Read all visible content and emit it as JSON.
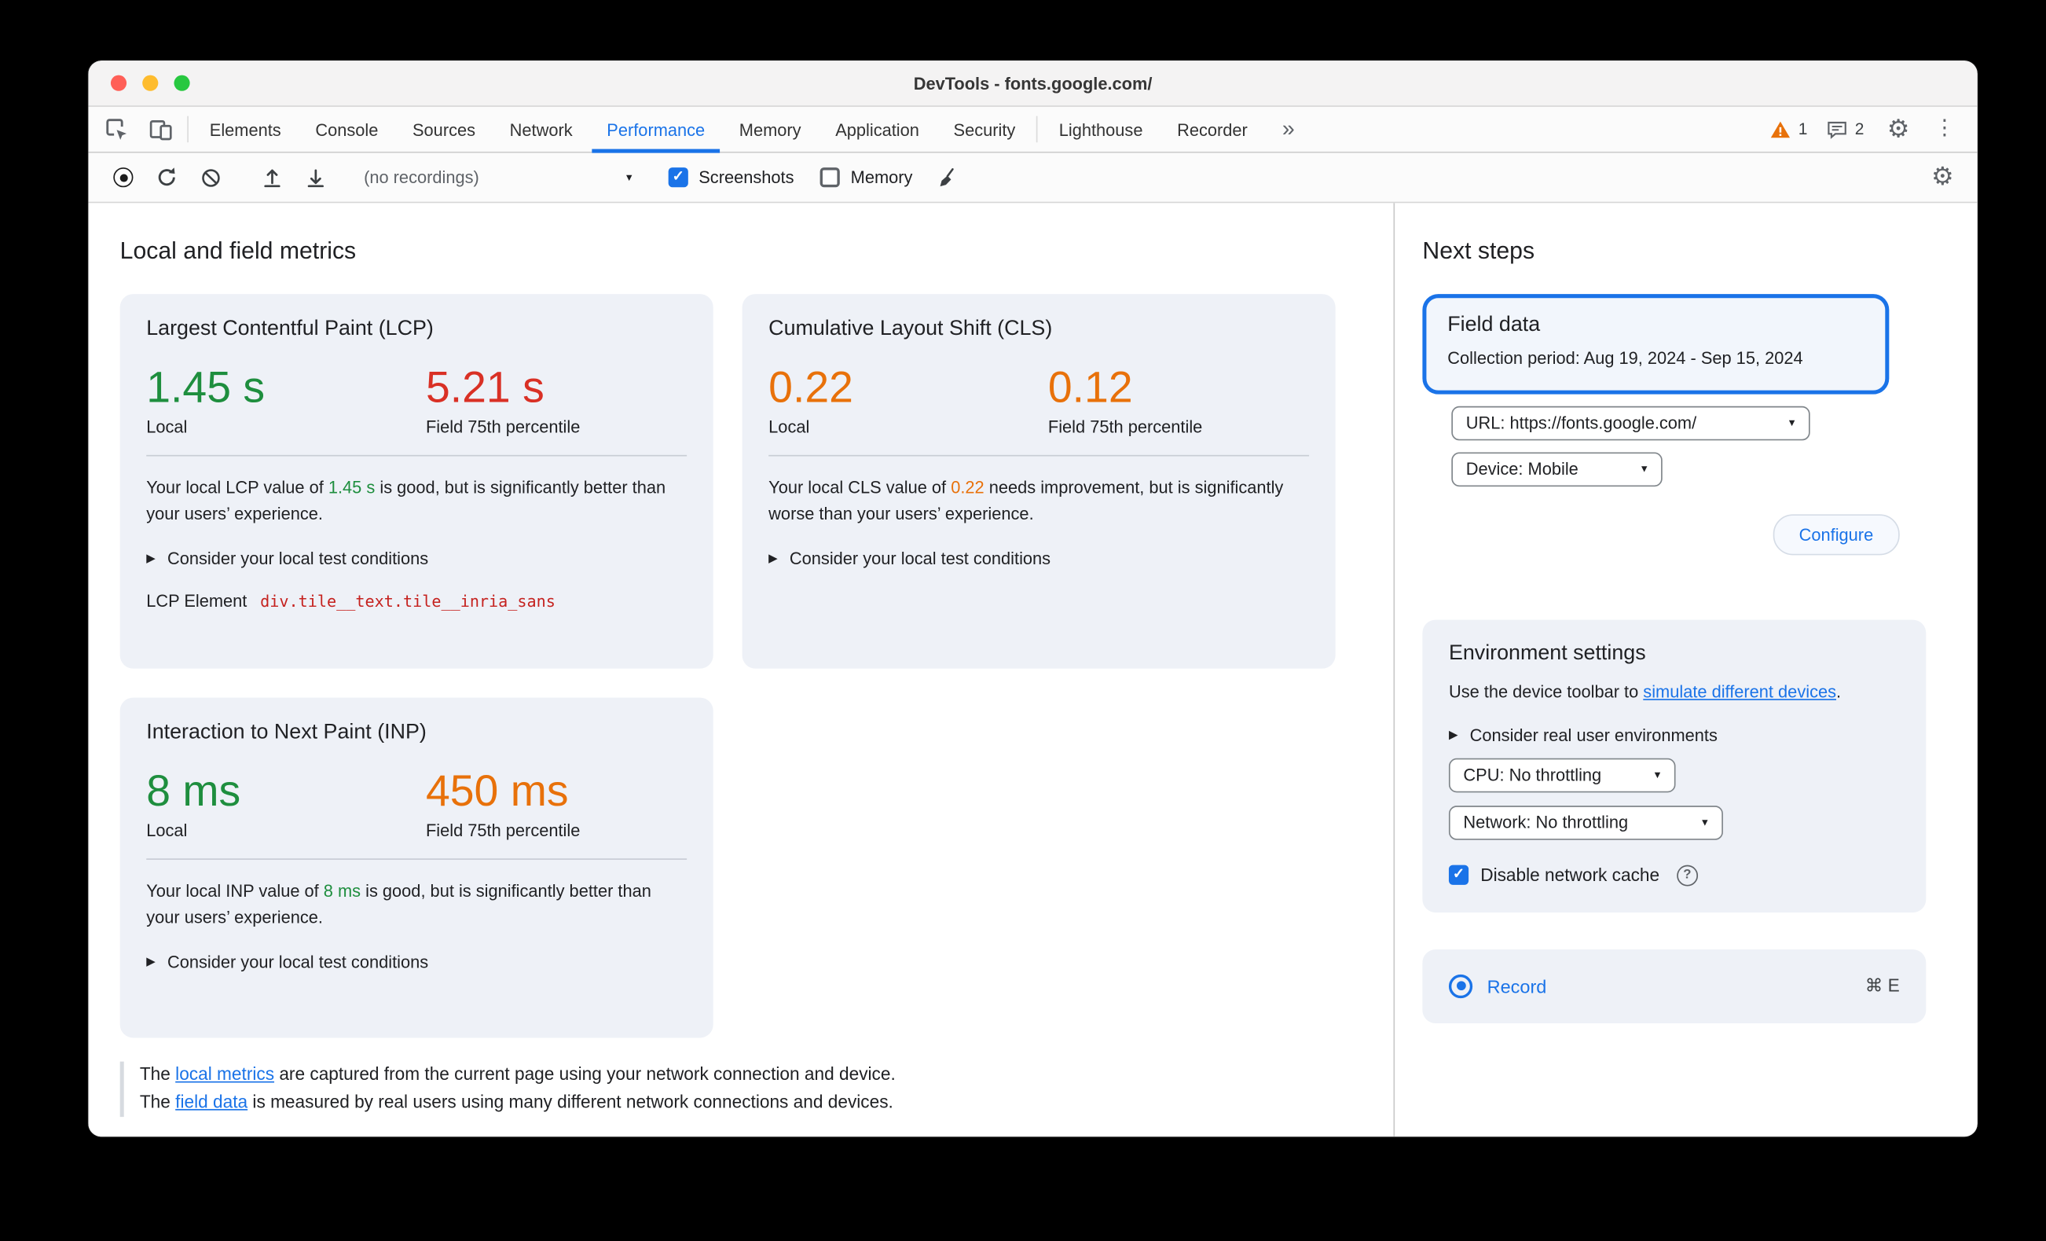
{
  "colors": {
    "accent": "#1a73e8",
    "good": "#1e8e3e",
    "poor": "#d93025",
    "needs_improvement": "#e8710a",
    "highlight_border": "#1a73e8"
  },
  "icons": {
    "check": "✓",
    "chevron": "▼",
    "disclosure": "▶",
    "gear": "⚙",
    "kebab": "⋮",
    "more_tabs": "»",
    "help": "?"
  },
  "window": {
    "title": "DevTools - fonts.google.com/"
  },
  "tabs": {
    "items": [
      "Elements",
      "Console",
      "Sources",
      "Network",
      "Performance",
      "Memory",
      "Application",
      "Security",
      "Lighthouse",
      "Recorder"
    ],
    "active": "Performance",
    "warning_count": "1",
    "message_count": "2"
  },
  "toolbar": {
    "recordings_label": "(no recordings)",
    "screenshots_label": "Screenshots",
    "memory_label": "Memory",
    "screenshots_checked": true,
    "memory_checked": false
  },
  "main": {
    "heading": "Local and field metrics",
    "cards": {
      "lcp": {
        "title": "Largest Contentful Paint (LCP)",
        "local_value": "1.45 s",
        "local_label": "Local",
        "field_value": "5.21 s",
        "field_label": "Field 75th percentile",
        "desc_pre": "Your local LCP value of ",
        "desc_value": "1.45 s",
        "desc_post": " is good, but is significantly better than your users’ experience.",
        "disclosure": "Consider your local test conditions",
        "element_label": "LCP Element",
        "element_value": "div.tile__text.tile__inria_sans"
      },
      "cls": {
        "title": "Cumulative Layout Shift (CLS)",
        "local_value": "0.22",
        "local_label": "Local",
        "field_value": "0.12",
        "field_label": "Field 75th percentile",
        "desc_pre": "Your local CLS value of ",
        "desc_value": "0.22",
        "desc_post": " needs improvement, but is significantly worse than your users’ experience.",
        "disclosure": "Consider your local test conditions"
      },
      "inp": {
        "title": "Interaction to Next Paint (INP)",
        "local_value": "8 ms",
        "local_label": "Local",
        "field_value": "450 ms",
        "field_label": "Field 75th percentile",
        "desc_pre": "Your local INP value of ",
        "desc_value": "8 ms",
        "desc_post": " is good, but is significantly better than your users’ experience.",
        "disclosure": "Consider your local test conditions"
      }
    },
    "footer": {
      "line1_pre": "The ",
      "line1_link": "local metrics",
      "line1_post": " are captured from the current page using your network connection and device.",
      "line2_pre": "The ",
      "line2_link": "field data",
      "line2_post": " is measured by real users using many different network connections and devices."
    }
  },
  "sidebar": {
    "heading": "Next steps",
    "field_data": {
      "title": "Field data",
      "collection_period": "Collection period: Aug 19, 2024 - Sep 15, 2024",
      "url_select": "URL: https://fonts.google.com/",
      "device_select": "Device: Mobile",
      "configure_label": "Configure"
    },
    "environment": {
      "title": "Environment settings",
      "desc_pre": "Use the device toolbar to ",
      "desc_link": "simulate different devices",
      "desc_post": ".",
      "disclosure": "Consider real user environments",
      "cpu_select": "CPU: No throttling",
      "network_select": "Network: No throttling",
      "cache_label": "Disable network cache"
    },
    "record": {
      "label": "Record",
      "shortcut": "⌘ E"
    }
  }
}
